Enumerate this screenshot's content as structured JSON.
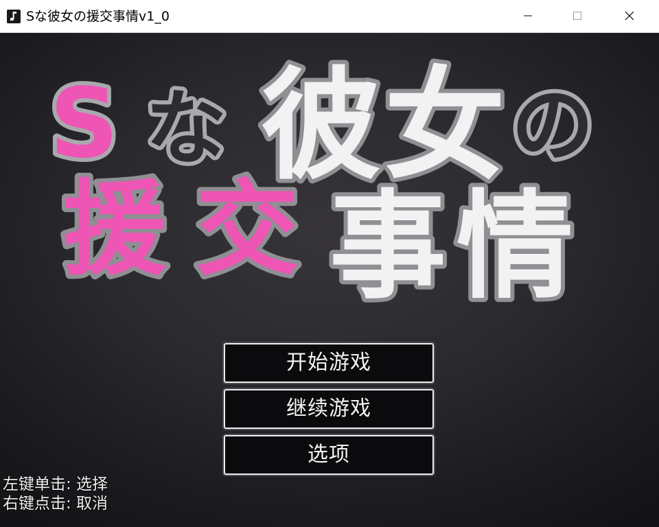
{
  "window": {
    "title": "Sな彼女の援交事情v1_0",
    "icon": "music-note-icon",
    "controls": [
      "minimize-icon",
      "maximize-icon",
      "close-icon"
    ]
  },
  "logo": {
    "line1": [
      "S",
      "な",
      "彼",
      "女",
      "の"
    ],
    "line2": [
      "援",
      "交",
      "事",
      "情"
    ],
    "colors": {
      "pink": "#ee55b4",
      "white": "#f2f2f2",
      "dark": "#2d2d31",
      "outline": "#a9a9ad"
    }
  },
  "menu": {
    "items": [
      {
        "label": "开始游戏"
      },
      {
        "label": "继续游戏"
      },
      {
        "label": "选项"
      }
    ]
  },
  "hints": {
    "left_click": "左键单击: 选择",
    "right_click": "右键点击: 取消"
  }
}
